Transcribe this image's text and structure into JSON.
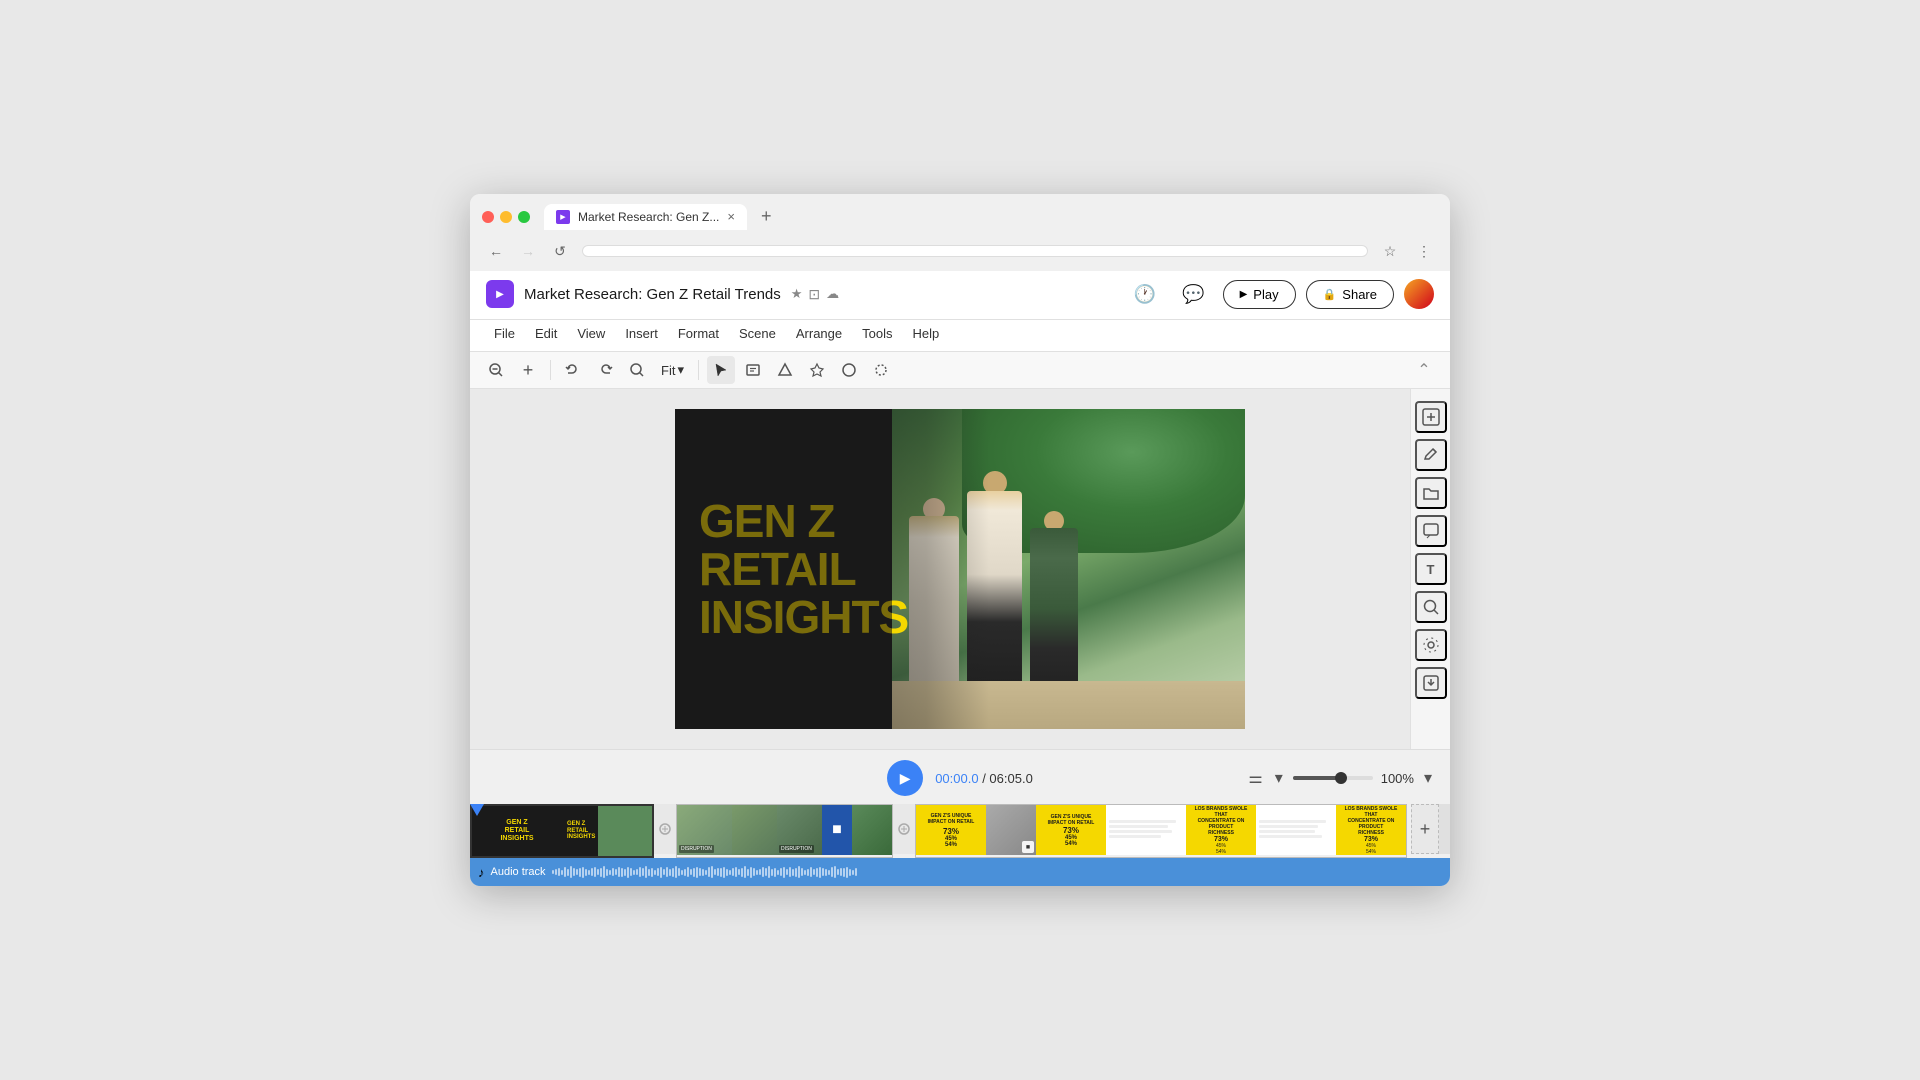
{
  "browser": {
    "tab_title": "Market Research: Gen Z...",
    "tab_favicon": "▶",
    "new_tab_icon": "+",
    "close_tab_icon": "×",
    "nav_back": "←",
    "nav_forward": "→",
    "nav_refresh": "↺",
    "address_bar_text": "",
    "bookmark_icon": "☆",
    "menu_icon": "⋮"
  },
  "app": {
    "logo_icon": "▶",
    "title": "Market Research: Gen Z Retail Trends",
    "star_icon": "★",
    "folder_icon": "⊡",
    "cloud_icon": "☁",
    "history_icon": "🕐",
    "comment_icon": "💬",
    "play_label": "Play",
    "share_label": "Share",
    "share_lock_icon": "🔒",
    "play_icon": "▶"
  },
  "menu": {
    "items": [
      "File",
      "Edit",
      "View",
      "Insert",
      "Format",
      "Scene",
      "Arrange",
      "Tools",
      "Help"
    ]
  },
  "toolbar": {
    "zoom_out_icon": "🔍",
    "zoom_in_icon": "+",
    "undo_icon": "↩",
    "redo_icon": "↪",
    "zoom_search_icon": "🔍",
    "fit_label": "Fit",
    "fit_arrow": "▾",
    "select_icon": "↖",
    "text_box_icon": "⬜",
    "shape_icon": "◻",
    "elements_icon": "⬡",
    "draw_icon": "○",
    "erase_icon": "◌",
    "collapse_icon": "⌃"
  },
  "slide": {
    "title_line1": "GEN Z",
    "title_line2": "RETAIL",
    "title_line3": "INSIGHTS"
  },
  "right_sidebar": {
    "icons": [
      "⊕",
      "✏",
      "📁",
      "💬",
      "T",
      "🔍",
      "⚙"
    ]
  },
  "timeline": {
    "play_icon": "▶",
    "current_time": "00:00.0",
    "total_time": "06:05.0",
    "time_separator": " / ",
    "align_icon": "⚌",
    "dropdown_icon": "▾",
    "zoom_level": "100%",
    "zoom_dropdown": "▾"
  },
  "audio_track": {
    "music_icon": "♪",
    "label": "Audio track"
  },
  "waveform_heights": [
    4,
    6,
    8,
    5,
    10,
    7,
    12,
    8,
    6,
    9,
    11,
    7,
    5,
    8,
    10,
    6,
    9,
    12,
    7,
    5,
    8,
    6,
    10,
    9,
    7,
    11,
    8,
    5,
    6,
    10,
    8,
    12,
    7,
    9,
    5,
    8,
    11,
    6,
    10,
    7,
    9,
    12,
    8,
    5,
    7,
    10,
    6,
    9,
    11,
    8,
    7,
    5,
    10,
    12,
    6,
    8,
    9,
    11,
    7,
    5,
    8,
    10,
    6,
    9,
    12,
    7,
    11,
    8,
    5,
    6,
    10,
    8,
    12,
    7,
    9,
    5,
    8,
    11,
    6,
    10,
    7,
    9,
    12,
    8,
    5,
    7,
    10,
    6,
    9,
    11,
    8,
    7,
    5,
    10,
    12,
    6,
    8,
    9,
    11,
    7,
    5,
    8
  ]
}
